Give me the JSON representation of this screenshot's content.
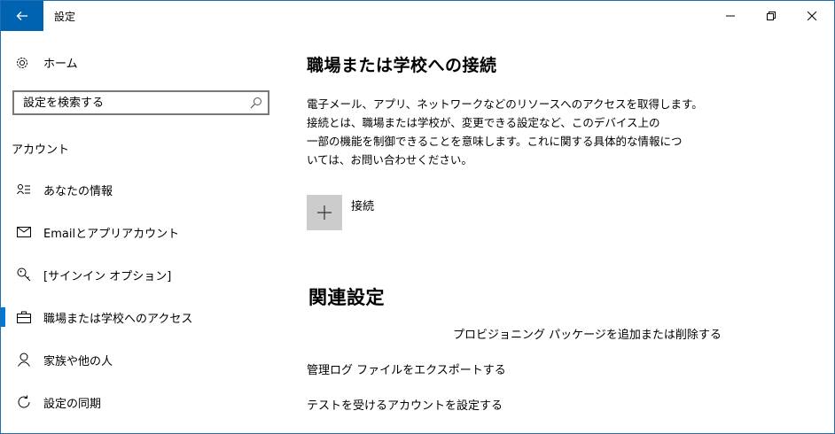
{
  "window": {
    "title": "設定",
    "controls": {
      "minimize": "—",
      "maximize": "❐",
      "close": "✕"
    }
  },
  "sidebar": {
    "home_label": "ホーム",
    "search": {
      "placeholder": "設定を検索する"
    },
    "section_header": "アカウント",
    "items": [
      {
        "label": "あなたの情報",
        "icon": "person-card-icon"
      },
      {
        "label": "Emailとアプリアカウント",
        "icon": "mail-icon"
      },
      {
        "label": "[サインイン オプション]",
        "icon": "key-icon"
      },
      {
        "label": "職場または学校へのアクセス",
        "icon": "briefcase-icon",
        "selected": true
      },
      {
        "label": "家族や他の人",
        "icon": "person-icon"
      },
      {
        "label": "設定の同期",
        "icon": "sync-icon"
      }
    ]
  },
  "main": {
    "title": "職場または学校への接続",
    "description_lines": [
      "電子メール、アプリ、ネットワークなどのリソースへのアクセスを取得します。",
      "接続とは、職場または学校が、変更できる設定など、このデバイス上の",
      "一部の機能を制御できることを意味します。これに関する具体的な情報につ",
      "いては、お問い合わせください。"
    ],
    "connect_label": "接続",
    "related_title": "関連設定",
    "related_links": [
      "プロビジョニング パッケージを追加または削除する",
      "管理ログ ファイルをエクスポートする",
      "テストを受けるアカウントを設定する"
    ]
  },
  "colors": {
    "accent": "#0078d7",
    "back_button": "#0063b1",
    "tile": "#cccccc",
    "window_border": "#1f6fb5"
  }
}
